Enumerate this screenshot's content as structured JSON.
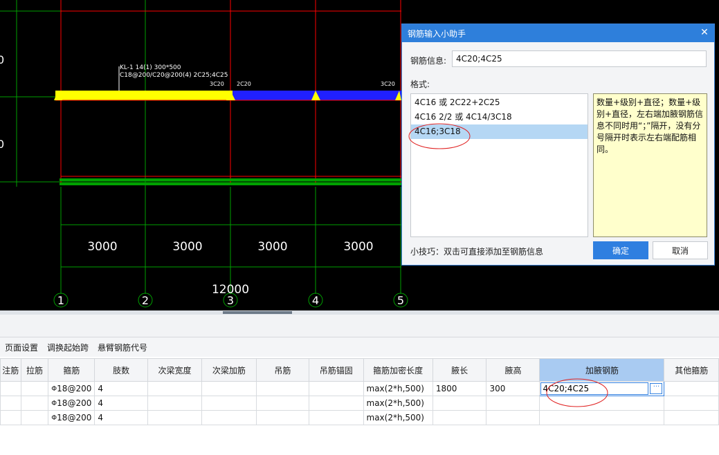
{
  "drawing": {
    "beam_label_line1": "KL-1  14(1) 300*500",
    "beam_label_line2": "C18@200/C20@200(4) 2C25;4C25",
    "rebar_tag_1": "3C20",
    "rebar_tag_2": "2C20",
    "rebar_tag_3": "3C20",
    "spans": [
      "3000",
      "3000",
      "3000",
      "3000"
    ],
    "total_length": "12000",
    "axes": [
      "1",
      "2",
      "3",
      "4",
      "5"
    ],
    "partial_digit_top": "0",
    "partial_digit_mid": "0",
    "colors": {
      "beam_yellow": "#ffff00",
      "beam_blue": "#2020ff",
      "grid_green": "#00a000",
      "column_red": "#ff0000"
    }
  },
  "dialog": {
    "title": "钢筋输入小助手",
    "close_icon": "close-icon",
    "info_label": "钢筋信息:",
    "info_value": "4C20;4C25",
    "format_label": "格式:",
    "formats": [
      "4C16 或 2C22+2C25",
      "4C16 2/2 或 4C14/3C18",
      "4C16;3C18"
    ],
    "selected_format_index": 2,
    "description": "数量+级别+直径；数量+级别+直径，左右端加腋钢筋信息不同时用“；”隔开，没有分号隔开时表示左右端配筋相同。",
    "tip": "小技巧：双击可直接添加至钢筋信息",
    "ok": "确定",
    "cancel": "取消"
  },
  "toolbar": {
    "items": [
      "页面设置",
      "调换起始跨",
      "悬臂钢筋代号"
    ]
  },
  "grid": {
    "columns": [
      "注筋",
      "拉筋",
      "箍筋",
      "肢数",
      "次梁宽度",
      "次梁加筋",
      "吊筋",
      "吊筋锚固",
      "箍筋加密长度",
      "腋长",
      "腋高",
      "加腋钢筋",
      "其他箍筋"
    ],
    "active_column": "加腋钢筋",
    "rows": [
      [
        "",
        "",
        "18@200",
        "4",
        "",
        "",
        "",
        "",
        "max(2*h,500)",
        "1800",
        "300",
        "4C20;4C25",
        ""
      ],
      [
        "",
        "",
        "18@200",
        "4",
        "",
        "",
        "",
        "",
        "max(2*h,500)",
        "",
        "",
        "",
        ""
      ],
      [
        "",
        "",
        "18@200",
        "4",
        "",
        "",
        "",
        "",
        "max(2*h,500)",
        "",
        "",
        "",
        ""
      ]
    ],
    "rebar_symbol": "Φ"
  }
}
